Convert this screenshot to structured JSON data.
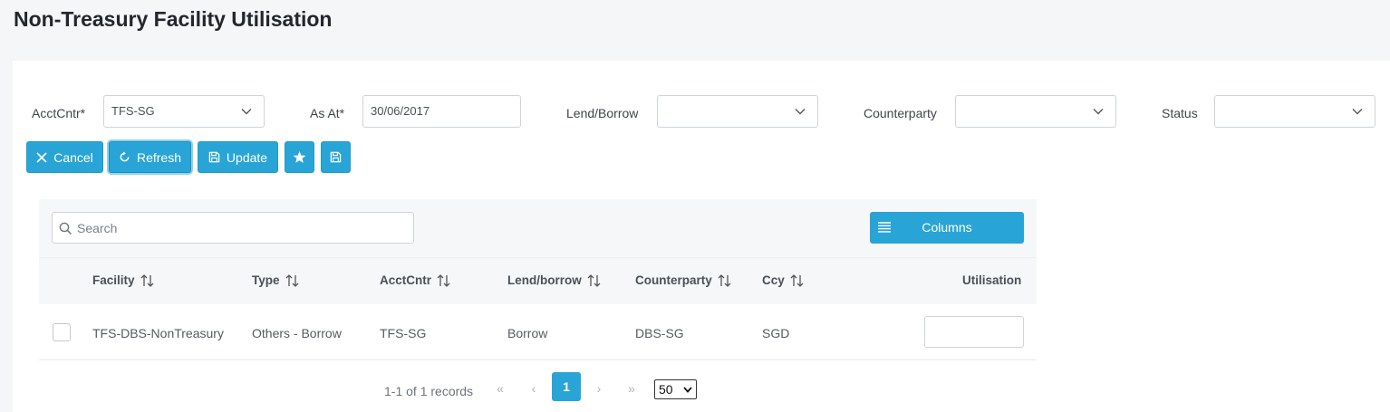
{
  "page": {
    "title": "Non-Treasury Facility Utilisation"
  },
  "filters": {
    "acctcntr": {
      "label": "AcctCntr*",
      "value": "TFS-SG"
    },
    "as_at": {
      "label": "As At*",
      "value": "30/06/2017"
    },
    "lend_borrow": {
      "label": "Lend/Borrow",
      "value": ""
    },
    "counterparty": {
      "label": "Counterparty",
      "value": ""
    },
    "status": {
      "label": "Status",
      "value": ""
    }
  },
  "toolbar": {
    "cancel_label": "Cancel",
    "refresh_label": "Refresh",
    "update_label": "Update",
    "favorite_icon": "star-icon",
    "save_icon": "floppy-icon"
  },
  "grid": {
    "search_placeholder": "Search",
    "columns_label": "Columns",
    "headers": [
      "Facility",
      "Type",
      "AcctCntr",
      "Lend/borrow",
      "Counterparty",
      "Ccy",
      "Utilisation"
    ],
    "rows": [
      {
        "facility": "TFS-DBS-NonTreasury",
        "type": "Others - Borrow",
        "acctcntr": "TFS-SG",
        "lend_borrow": "Borrow",
        "counterparty": "DBS-SG",
        "ccy": "SGD",
        "utilisation": ""
      }
    ]
  },
  "pager": {
    "records_text": "1-1 of 1 records",
    "first": "«",
    "prev": "‹",
    "current_page": "1",
    "next": "›",
    "last": "»",
    "page_size": "50"
  },
  "colors": {
    "accent": "#28a5d6",
    "background": "#f4f6f8"
  }
}
